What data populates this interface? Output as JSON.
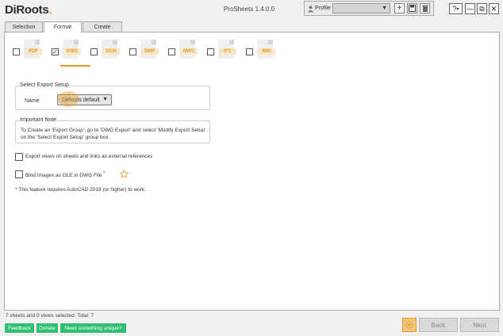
{
  "app": {
    "logo_main": "DiRoots",
    "title": "ProSheets 1.4.0.0"
  },
  "profile": {
    "label": "Profile",
    "selected": ""
  },
  "window": {
    "help": "?",
    "help_caret": "▾",
    "minimize": "—",
    "restore": "⧉",
    "close": "✕"
  },
  "tabs": [
    {
      "label": "Selection"
    },
    {
      "label": "Format"
    },
    {
      "label": "Create"
    }
  ],
  "formats": [
    {
      "label": "PDF",
      "checked": false
    },
    {
      "label": "DWG",
      "checked": true
    },
    {
      "label": "DGN",
      "checked": false
    },
    {
      "label": "DWF",
      "checked": false
    },
    {
      "label": "NWC",
      "checked": false
    },
    {
      "label": "IFC",
      "checked": false
    },
    {
      "label": "IMG",
      "checked": false
    }
  ],
  "export_setup": {
    "legend": "Select Export Setup",
    "name_label": "Name",
    "selected": "DiRoots default"
  },
  "important_note": {
    "legend": "Important Note",
    "text": "To Create an 'Export Group', go to 'DWG Export' and select 'Modify Export Setup' on the 'Select Export Setup' group box."
  },
  "options": {
    "external_refs": "Export views on sheets and links as external references",
    "bind_images": "Bind Images as OLE in DWG File",
    "bind_asterisk": "*"
  },
  "footnote": "* This feature requires AutoCAD 2019 (or higher) to work.",
  "status": "7 sheets and 0 views selected. Total: 7",
  "footer": {
    "feedback": "Feedback",
    "donate": "Donate",
    "unique": "Need something unique?",
    "back": "Back",
    "next": "Next"
  },
  "colors": {
    "accent": "#e39b26",
    "green": "#2fbf71"
  }
}
